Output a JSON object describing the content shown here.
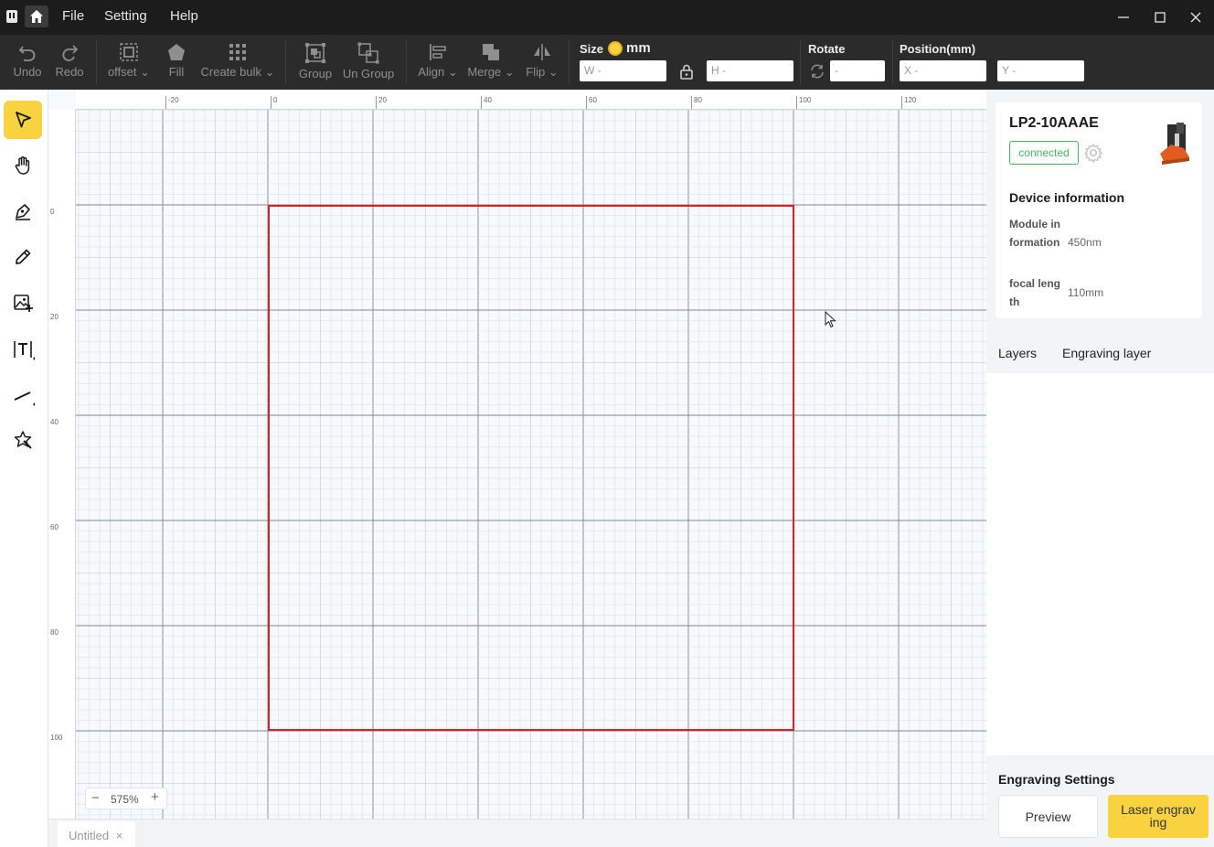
{
  "menu": {
    "file": "File",
    "setting": "Setting",
    "help": "Help"
  },
  "toolbar": {
    "undo": "Undo",
    "redo": "Redo",
    "offset": "offset",
    "fill": "Fill",
    "create_bulk": "Create bulk",
    "group": "Group",
    "ungroup": "Un Group",
    "align": "Align",
    "merge": "Merge",
    "flip": "Flip",
    "size_label": "Size",
    "unit": "mm",
    "w_placeholder": "W -",
    "h_placeholder": "H -",
    "rotate_label": "Rotate",
    "rotate_placeholder": "-",
    "position_label": "Position(mm)",
    "x_placeholder": "X -",
    "y_placeholder": "Y -"
  },
  "canvas": {
    "h_ruler_ticks": [
      "-20",
      "0",
      "20",
      "40",
      "60",
      "80",
      "100",
      "120"
    ],
    "v_ruler_ticks": [
      "0",
      "20",
      "40",
      "60",
      "80",
      "100"
    ],
    "zoom": "575%",
    "zoom_out": "−",
    "zoom_in": "+",
    "work_area_color": "#e0201f"
  },
  "file_tabs": [
    {
      "label": "Untitled",
      "close": "×"
    }
  ],
  "device": {
    "name": "LP2-10AAAE",
    "status": "connected",
    "info_title": "Device information",
    "module_key": "Module information",
    "module_val": "450nm",
    "focal_key": "focal length",
    "focal_val": "110mm"
  },
  "panel_tabs": {
    "layers": "Layers",
    "engraving_layer": "Engraving layer"
  },
  "engraving": {
    "title": "Engraving Settings",
    "preview": "Preview",
    "laser": "Laser engraving"
  },
  "colors": {
    "accent": "#f8d33f",
    "connected": "#3fb95a",
    "dark_bar": "#2b2b2b"
  },
  "left_tools": [
    "select-icon",
    "hand-icon",
    "pen-icon",
    "pencil-icon",
    "add-image-icon",
    "text-icon",
    "line-icon",
    "magic-icon"
  ]
}
